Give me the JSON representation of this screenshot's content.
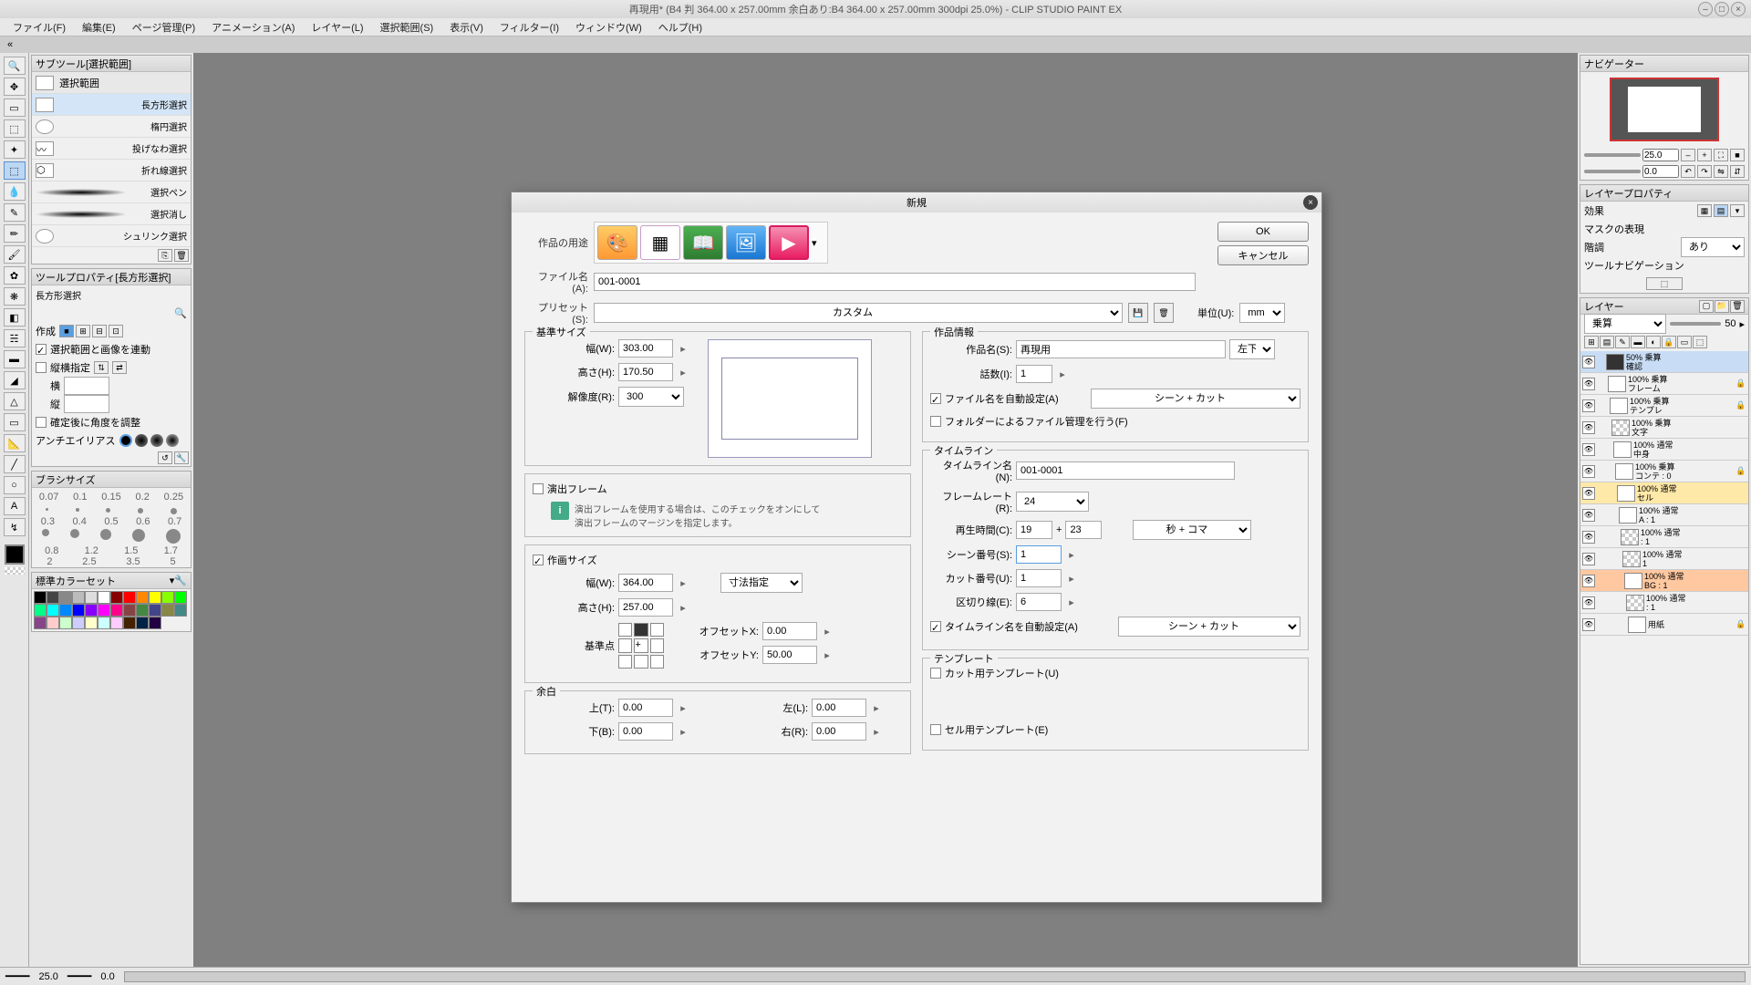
{
  "titlebar": {
    "text": "再現用* (B4 判 364.00 x 257.00mm 余白あり:B4 364.00 x 257.00mm 300dpi 25.0%)  - CLIP STUDIO PAINT EX"
  },
  "menu": {
    "file": "ファイル(F)",
    "edit": "編集(E)",
    "page": "ページ管理(P)",
    "anim": "アニメーション(A)",
    "layer": "レイヤー(L)",
    "select": "選択範囲(S)",
    "view": "表示(V)",
    "filter": "フィルター(I)",
    "window": "ウィンドウ(W)",
    "help": "ヘルプ(H)"
  },
  "subtool": {
    "title": "サブツール[選択範囲]",
    "group": "選択範囲",
    "items": [
      {
        "label": "長方形選択"
      },
      {
        "label": "楕円選択"
      },
      {
        "label": "投げなわ選択"
      },
      {
        "label": "折れ線選択"
      },
      {
        "label": "選択ペン"
      },
      {
        "label": "選択消し"
      },
      {
        "label": "シュリンク選択"
      }
    ]
  },
  "toolprop": {
    "title": "ツールプロパティ[長方形選択]",
    "subtitle": "長方形選択",
    "make": "作成",
    "sync": "選択範囲と画像を連動",
    "wh": "縦横指定",
    "w": "横",
    "h": "縦",
    "angle": "確定後に角度を調整",
    "anti": "アンチエイリアス"
  },
  "brushsize": {
    "title": "ブラシサイズ",
    "row1": [
      "0.07",
      "0.1",
      "0.15",
      "0.2",
      "0.25"
    ],
    "row2": [
      "0.3",
      "0.4",
      "0.5",
      "0.6",
      "0.7"
    ],
    "row3": [
      "0.8",
      "1.2",
      "1.5",
      "1.7"
    ],
    "row4": [
      "2",
      "2.5",
      "3.5",
      "5"
    ]
  },
  "colorset": {
    "title": "標準カラーセット"
  },
  "navigator": {
    "title": "ナビゲーター",
    "zoom": "25.0",
    "angle": "0.0"
  },
  "layerprop": {
    "title": "レイヤープロパティ",
    "effect": "効果",
    "mask": "マスクの表現",
    "tone": "階調",
    "tone_val": "あり",
    "toolnav": "ツールナビゲーション"
  },
  "layers": {
    "title": "レイヤー",
    "mode": "乗算",
    "opacity": "50",
    "items": [
      {
        "name": "50% 乗算\n確認",
        "sel": true,
        "thumb": "dark"
      },
      {
        "name": "100% 乗算\nフレーム",
        "lock": true
      },
      {
        "name": "100% 乗算\nテンプレ",
        "lock": true
      },
      {
        "name": "100% 乗算\n文字",
        "thumb": "chk"
      },
      {
        "name": "100% 通常\n中身"
      },
      {
        "name": "100% 乗算\nコンテ : 0",
        "lock": true
      },
      {
        "name": "100% 通常\nセル",
        "hl": "y"
      },
      {
        "name": "100% 通常\nA : 1"
      },
      {
        "name": "100% 通常\n: 1",
        "thumb": "chk"
      },
      {
        "name": "100% 通常\n1",
        "thumb": "chk"
      },
      {
        "name": "100% 通常\nBG : 1",
        "hl": "o"
      },
      {
        "name": "100% 通常\n: 1",
        "thumb": "chk"
      },
      {
        "name": "用紙",
        "lock": true
      }
    ]
  },
  "statusbar": {
    "zoom": "25.0",
    "angle": "0.0"
  },
  "dialog": {
    "title": "新規",
    "ok": "OK",
    "cancel": "キャンセル",
    "purpose_label": "作品の用途",
    "filename_label": "ファイル名(A):",
    "filename": "001-0001",
    "preset_label": "プリセット(S):",
    "preset": "カスタム",
    "unit_label": "単位(U):",
    "unit": "mm",
    "basesize": {
      "legend": "基準サイズ",
      "w_label": "幅(W):",
      "w": "303.00",
      "h_label": "高さ(H):",
      "h": "170.50",
      "res_label": "解像度(R):",
      "res": "300"
    },
    "direction": {
      "legend": "演出フレーム",
      "note": "演出フレームを使用する場合は、このチェックをオンにして\n演出フレームのマージンを指定します。"
    },
    "drawsize": {
      "legend": "作画サイズ",
      "w_label": "幅(W):",
      "w": "364.00",
      "h_label": "高さ(H):",
      "h": "257.00",
      "dimbtn": "寸法指定",
      "anchor": "基準点",
      "ox_label": "オフセットX:",
      "ox": "0.00",
      "oy_label": "オフセットY:",
      "oy": "50.00"
    },
    "margin": {
      "legend": "余白",
      "t_label": "上(T):",
      "t": "0.00",
      "b_label": "下(B):",
      "b": "0.00",
      "l_label": "左(L):",
      "l": "0.00",
      "r_label": "右(R):",
      "r": "0.00"
    },
    "workinfo": {
      "legend": "作品情報",
      "name_label": "作品名(S):",
      "name": "再現用",
      "corner": "左下",
      "ep_label": "話数(I):",
      "ep": "1",
      "autofile": "ファイル名を自動設定(A)",
      "autofile_val": "シーン + カット",
      "folder": "フォルダーによるファイル管理を行う(F)"
    },
    "timeline": {
      "legend": "タイムライン",
      "name_label": "タイムライン名(N):",
      "name": "001-0001",
      "fps_label": "フレームレート(R):",
      "fps": "24",
      "play_label": "再生時間(C):",
      "play1": "19",
      "play2": "23",
      "play_unit": "秒 + コマ",
      "scene_label": "シーン番号(S):",
      "scene": "1",
      "cut_label": "カット番号(U):",
      "cut": "1",
      "div_label": "区切り線(E):",
      "div": "6",
      "autoname": "タイムライン名を自動設定(A)",
      "autoname_val": "シーン + カット"
    },
    "template": {
      "legend": "テンプレート",
      "cut": "カット用テンプレート(U)",
      "cel": "セル用テンプレート(E)"
    }
  }
}
